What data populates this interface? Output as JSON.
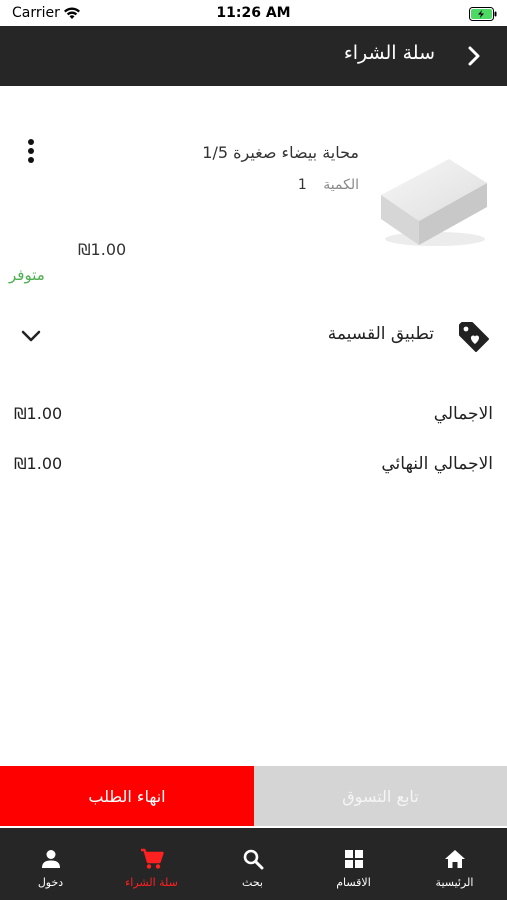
{
  "status_bar": {
    "carrier": "Carrier",
    "time": "11:26 AM"
  },
  "header": {
    "title": "سلة الشراء",
    "back_icon": "chevron-right-icon"
  },
  "cart_item": {
    "name": "محاية بيضاء صغيرة 1/5",
    "quantity_label": "الكمية",
    "quantity": "1",
    "price": "₪1.00",
    "stock_status": "متوفر",
    "stock_color": "#4caf50"
  },
  "coupon": {
    "label": "تطبيق القسيمة"
  },
  "totals": {
    "subtotal_label": "الاجمالي",
    "subtotal_value": "₪1.00",
    "final_label": "الاجمالي النهائي",
    "final_value": "₪1.00"
  },
  "actions": {
    "checkout_label": "انهاء الطلب",
    "continue_label": "تابع التسوق",
    "checkout_color": "#ff0000"
  },
  "bottom_nav": {
    "items": [
      {
        "label": "دخول",
        "icon": "person-icon"
      },
      {
        "label": "سلة الشراء",
        "icon": "cart-icon"
      },
      {
        "label": "بحث",
        "icon": "search-icon"
      },
      {
        "label": "الاقسام",
        "icon": "grid-icon"
      },
      {
        "label": "الرئيسية",
        "icon": "home-icon"
      }
    ],
    "active_color": "#ff2020"
  }
}
